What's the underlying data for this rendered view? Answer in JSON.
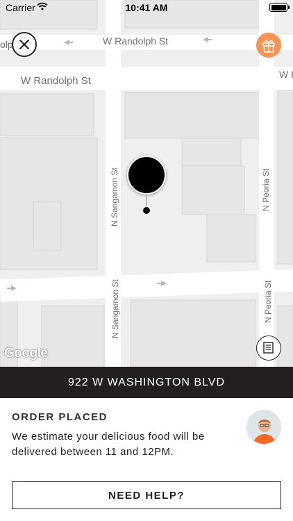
{
  "status_bar": {
    "carrier": "Carrier",
    "time": "10:41 AM"
  },
  "map": {
    "streets": {
      "randolph_top": "W Randolph St",
      "randolph_main": "W Randolph St",
      "randolph_right": "W R",
      "partial_left": "olp",
      "sangamon_upper": "N Sangamon St",
      "sangamon_lower": "N Sangamon St",
      "peoria_upper": "N Peoria St",
      "peoria_lower": "N Peoria St"
    },
    "attribution": "Google"
  },
  "icons": {
    "close": "close-icon",
    "gift": "gift-icon",
    "menu": "receipt-icon",
    "pin": "location-pin-icon"
  },
  "colors": {
    "accent": "#f59455",
    "address_bar": "#231f20"
  },
  "order": {
    "address": "922 W WASHINGTON BLVD",
    "status_title": "ORDER PLACED",
    "status_message": "We estimate your delicious food will be delivered between 11 and 12PM.",
    "help_button": "NEED HELP?"
  }
}
